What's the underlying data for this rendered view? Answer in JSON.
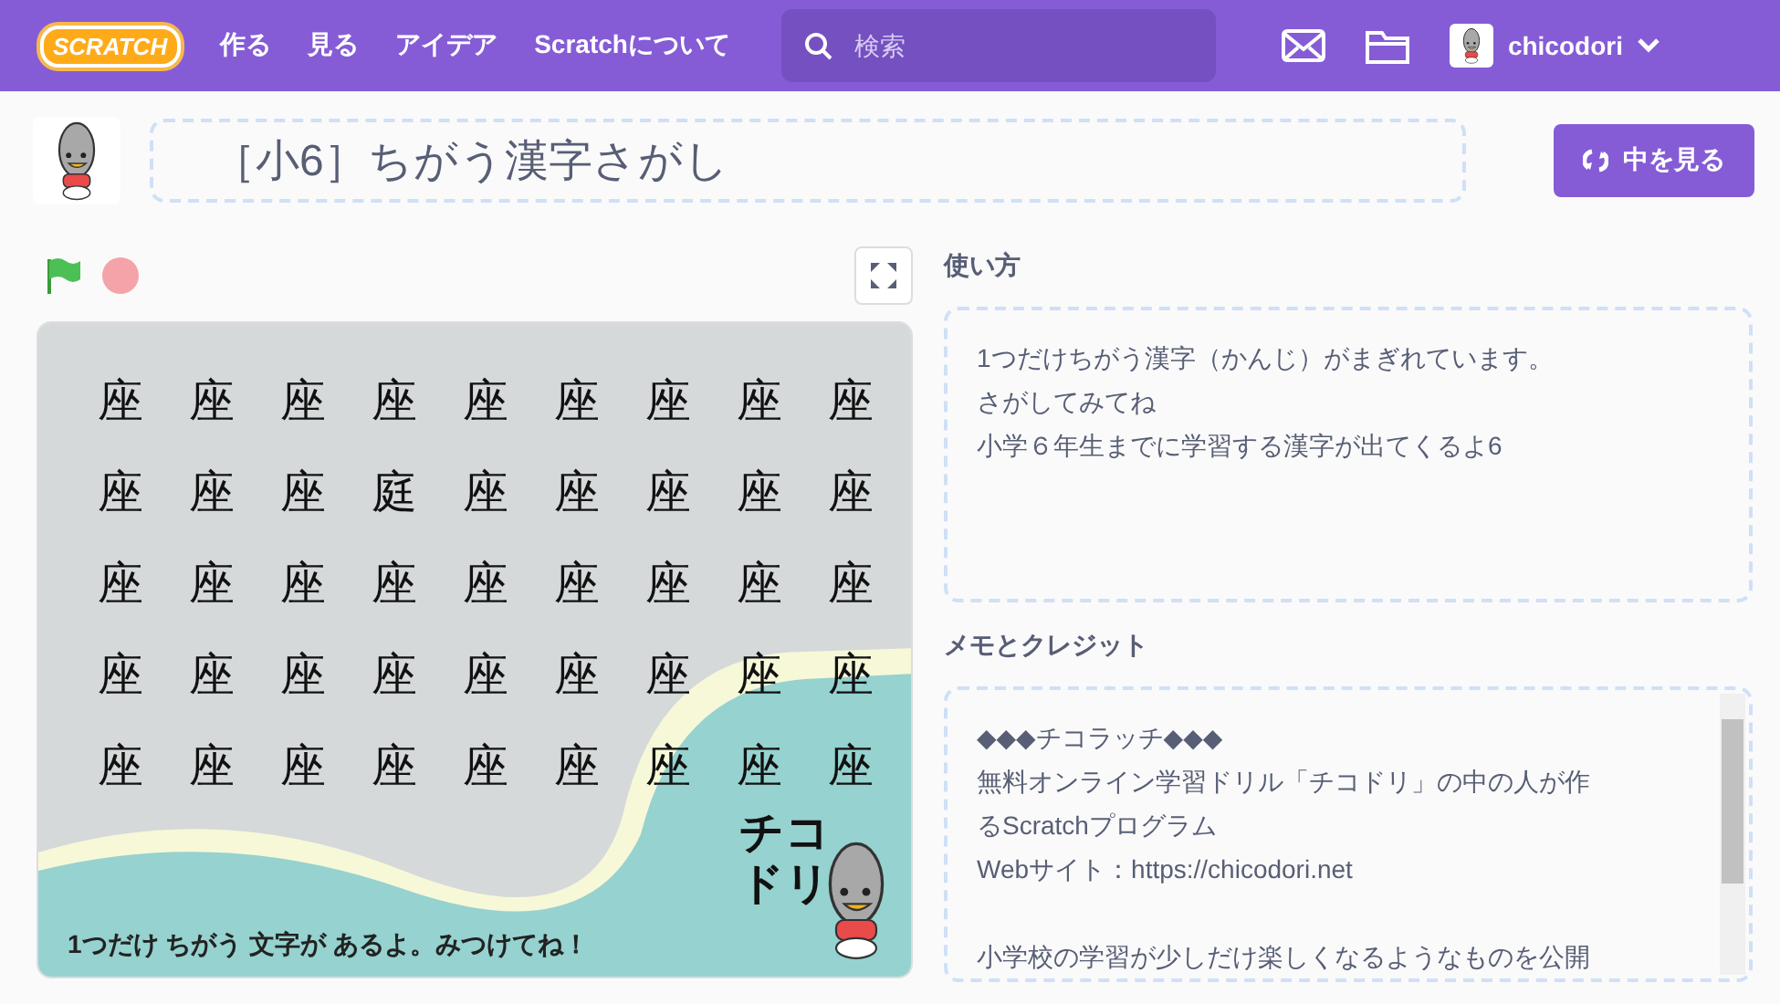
{
  "nav": {
    "logo": "SCRATCH",
    "links": [
      "作る",
      "見る",
      "アイデア",
      "Scratchについて"
    ],
    "search": {
      "placeholder": "検索"
    },
    "username": "chicodori"
  },
  "project": {
    "title": "［小6］ちがう漢字さがし",
    "see_inside": "中を見る"
  },
  "stage": {
    "grid": [
      "座座座座座座座座座",
      "座座座庭座座座座座",
      "座座座座座座座座座",
      "座座座座座座座座座",
      "座座座座座座座座座"
    ],
    "logo_lines": [
      "チコ",
      "ドリ"
    ],
    "caption": "1つだけ ちがう 文字が あるよ。みつけてね！"
  },
  "instructions": {
    "heading": "使い方",
    "lines": [
      "1つだけちがう漢字（かんじ）がまぎれています。",
      "さがしてみてね",
      "小学６年生までに学習する漢字が出てくるよ6"
    ]
  },
  "notes": {
    "heading": "メモとクレジット",
    "paragraphs": [
      [
        "◆◆◆チコラッチ◆◆◆",
        "無料オンライン学習ドリル「チコドリ」の中の人が作",
        "るScratchプログラム",
        "Webサイト：https://chicodori.net"
      ],
      [
        "小学校の学習が少しだけ楽しくなるようなものを公開"
      ]
    ]
  }
}
